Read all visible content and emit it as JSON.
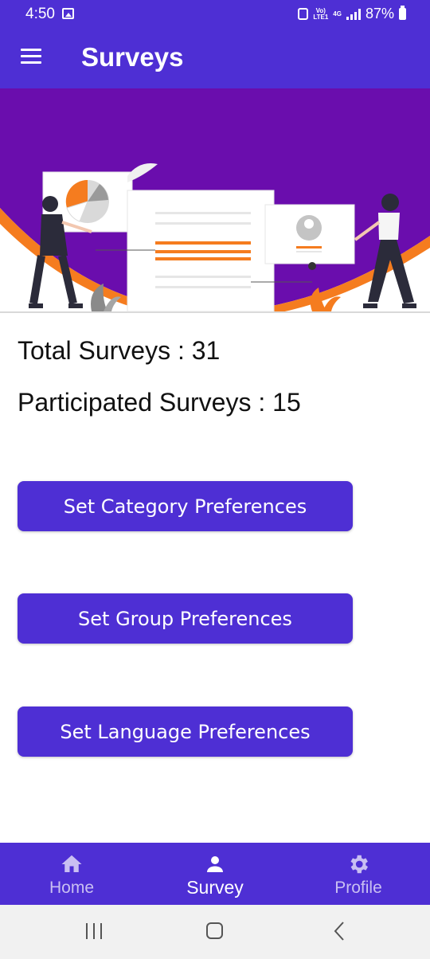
{
  "status_bar": {
    "time": "4:50",
    "network_top": "Vo)",
    "network_bottom": "LTE1",
    "network_type": "4G",
    "battery": "87%"
  },
  "app_bar": {
    "title": "Surveys",
    "menu_icon": "hamburger-menu-icon"
  },
  "stats": {
    "total": "Total Surveys : 31",
    "participated": "Participated Surveys : 15"
  },
  "buttons": {
    "category": "Set Category Preferences",
    "group": "Set Group Preferences",
    "language": "Set Language Preferences"
  },
  "bottom_nav": {
    "items": [
      {
        "label": "Home",
        "icon": "home-icon",
        "active": false
      },
      {
        "label": "Survey",
        "icon": "person-icon",
        "active": true
      },
      {
        "label": "Profile",
        "icon": "gear-icon",
        "active": false
      }
    ]
  },
  "colors": {
    "primary": "#4e2fd4",
    "hero_purple": "#6a0dad",
    "accent_orange": "#f57c1f"
  }
}
